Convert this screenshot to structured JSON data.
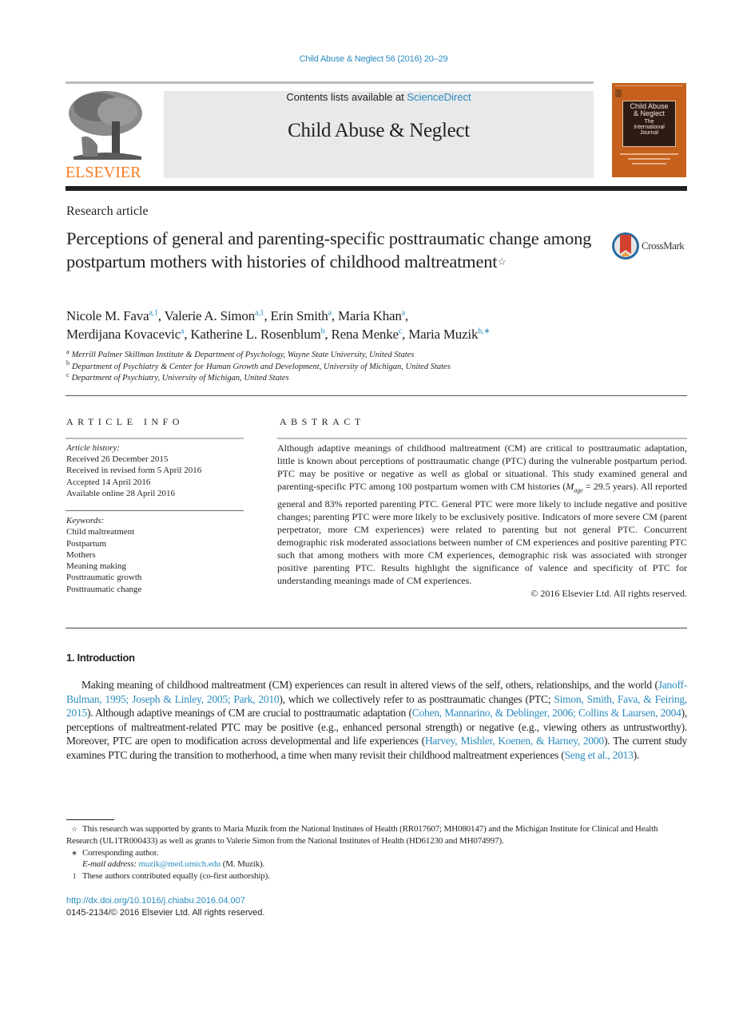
{
  "journal_ref": "Child Abuse & Neglect 56 (2016) 20–29",
  "header": {
    "contents_prefix": "Contents lists available at ",
    "contents_link": "ScienceDirect",
    "journal_title": "Child Abuse & Neglect",
    "publisher": "ELSEVIER",
    "cover": {
      "title_line1": "Child Abuse",
      "title_line2": "& Neglect",
      "subtitle_line1": "The",
      "subtitle_line2": "International",
      "subtitle_line3": "Journal"
    },
    "colors": {
      "link": "#2a8cbf",
      "elsevier_orange": "#f47b20",
      "cover_orange": "#c6601d"
    }
  },
  "article": {
    "type": "Research article",
    "title": "Perceptions of general and parenting-specific posttraumatic change among postpartum mothers with histories of childhood maltreatment",
    "title_footnote_mark": "☆",
    "crossmark_label": "CrossMark",
    "authors": [
      {
        "name": "Nicole M. Fava",
        "sup": "a,1",
        "sep": ", "
      },
      {
        "name": "Valerie A. Simon",
        "sup": "a,1",
        "sep": ", "
      },
      {
        "name": "Erin Smith",
        "sup": "a",
        "sep": ", "
      },
      {
        "name": "Maria Khan",
        "sup": "a",
        "sep": ","
      },
      {
        "name": "Merdijana Kovacevic",
        "sup": "a",
        "sep": ", "
      },
      {
        "name": "Katherine L. Rosenblum",
        "sup": "b",
        "sep": ", "
      },
      {
        "name": "Rena Menke",
        "sup": "c",
        "sep": ", "
      },
      {
        "name": "Maria Muzik",
        "sup": "b,∗",
        "sep": ""
      }
    ],
    "affiliations": [
      {
        "letter": "a",
        "text": "Merrill Palmer Skillman Institute & Department of Psychology, Wayne State University, United States"
      },
      {
        "letter": "b",
        "text": "Department of Psychiatry & Center for Human Growth and Development, University of Michigan, United States"
      },
      {
        "letter": "c",
        "text": "Department of Psychiatry, University of Michigan, United States"
      }
    ]
  },
  "article_info": {
    "heading": "ARTICLE INFO",
    "history_label": "Article history:",
    "history": [
      "Received 26 December 2015",
      "Received in revised form 5 April 2016",
      "Accepted 14 April 2016",
      "Available online 28 April 2016"
    ],
    "keywords_label": "Keywords:",
    "keywords": [
      "Child maltreatment",
      "Postpartum",
      "Mothers",
      "Meaning making",
      "Posttraumatic growth",
      "Posttraumatic change"
    ]
  },
  "abstract": {
    "heading": "ABSTRACT",
    "part1": "Although adaptive meanings of childhood maltreatment (CM) are critical to posttraumatic adaptation, little is known about perceptions of posttraumatic change (PTC) during the vul­nerable postpartum period. PTC may be positive or negative as well as global or situational. This study examined general and parenting-specific PTC among 100 postpartum women with CM histories (",
    "m_symbol": "M",
    "m_sub": "age",
    "part2": " = 29.5 years). All reported general and 83% reported parenting PTC. General PTC were more likely to include negative and positive changes; parenting PTC were more likely to be exclusively positive. Indicators of more severe CM (parent perpe­trator, more CM experiences) were related to parenting but not general PTC. Concurrent demographic risk moderated associations between number of CM experiences and posi­tive parenting PTC such that among mothers with more CM experiences, demographic risk was associated with stronger positive parenting PTC. Results highlight the significance of valence and specificity of PTC for understanding meanings made of CM experiences.",
    "copyright": "© 2016 Elsevier Ltd. All rights reserved."
  },
  "introduction": {
    "heading": "1.  Introduction",
    "segments": [
      {
        "t": "Making meaning of childhood maltreatment (CM) experiences can result in altered views of the self, others, relationships, and the world (",
        "link": false
      },
      {
        "t": "Janoff-Bulman, 1995; Joseph & Linley, 2005; Park, 2010",
        "link": true
      },
      {
        "t": "), which we collectively refer to as posttraumatic changes (PTC; ",
        "link": false
      },
      {
        "t": "Simon, Smith, Fava, & Feiring, 2015",
        "link": true
      },
      {
        "t": "). Although adaptive meanings of CM are crucial to posttraumatic adaptation (",
        "link": false
      },
      {
        "t": "Cohen, Mannarino, & Deblinger, 2006; Collins & Laursen, 2004",
        "link": true
      },
      {
        "t": "), perceptions of maltreatment-related PTC may be positive (e.g., enhanced personal strength) or negative (e.g., viewing others as untrustworthy). Moreover, PTC are open to modification across developmental and life experiences (",
        "link": false
      },
      {
        "t": "Harvey, Mishler, Koenen, & Harney, 2000",
        "link": true
      },
      {
        "t": "). The current study examines PTC during the transition to motherhood, a time when many revisit their childhood maltreatment experiences (",
        "link": false
      },
      {
        "t": "Seng et al., 2013",
        "link": true
      },
      {
        "t": ").",
        "link": false
      }
    ]
  },
  "footnotes": {
    "star_mark": "☆",
    "star_text": "This research was supported by grants to Maria Muzik from the National Institutes of Health (RR017607; MH080147) and the Michigan Institute for Clinical and Health Research (UL1TR000433) as well as grants to Valerie Simon from the National Institutes of Health (HD61230 and MH074997).",
    "corr_mark": "∗",
    "corr_text": "Corresponding author.",
    "email_label": "E-mail address:",
    "email": "muzik@med.umich.edu",
    "email_suffix": " (M. Muzik).",
    "equal_mark": "1",
    "equal_text": "These authors contributed equally (co-first authorship)."
  },
  "doi": {
    "url": "http://dx.doi.org/10.1016/j.chiabu.2016.04.007",
    "issn_copyright": "0145-2134/© 2016 Elsevier Ltd. All rights reserved."
  }
}
